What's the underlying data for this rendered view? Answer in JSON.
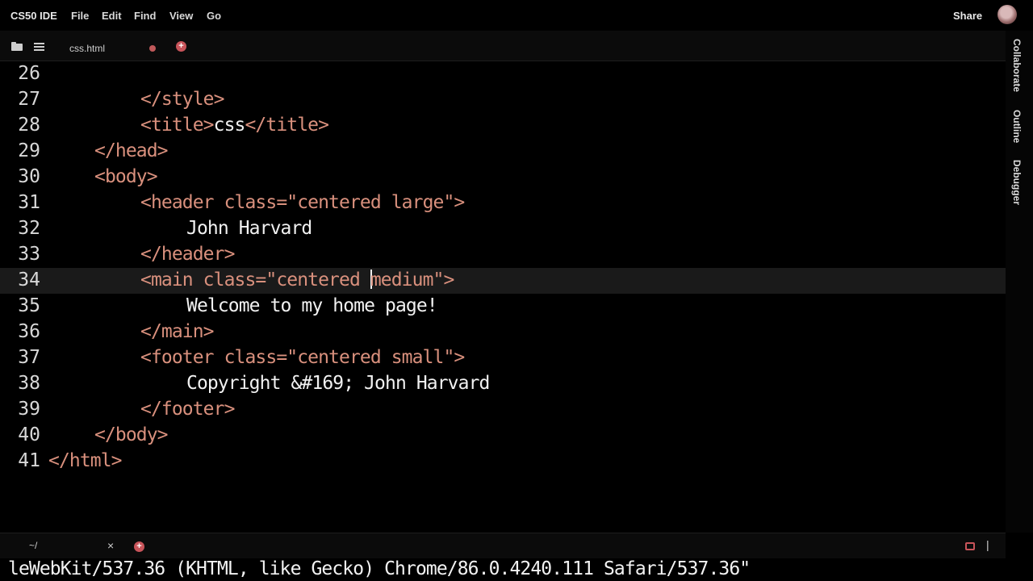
{
  "app": {
    "brand": "CS50 IDE",
    "menu": [
      "File",
      "Edit",
      "Find",
      "View",
      "Go"
    ],
    "share_label": "Share"
  },
  "tabs": {
    "active_file": "css.html",
    "icons": [
      "folder-icon",
      "list-icon",
      "unsaved-dot-icon",
      "plus-icon"
    ]
  },
  "side_panel": [
    "Collaborate",
    "Outline",
    "Debugger"
  ],
  "editor": {
    "active_line": "34",
    "lines": [
      {
        "num": "26",
        "segs": []
      },
      {
        "num": "27",
        "segs": [
          {
            "t": "</style>",
            "c": "tag"
          }
        ]
      },
      {
        "num": "28",
        "segs": [
          {
            "t": "<title>",
            "c": "tag"
          },
          {
            "t": "css",
            "c": "txt"
          },
          {
            "t": "</title>",
            "c": "tag"
          }
        ]
      },
      {
        "num": "29",
        "segs": [
          {
            "t": "</head>",
            "c": "tag"
          }
        ]
      },
      {
        "num": "30",
        "segs": [
          {
            "t": "<body>",
            "c": "tag"
          }
        ]
      },
      {
        "num": "31",
        "segs": [
          {
            "t": "<header class=\"centered large\">",
            "c": "tag"
          }
        ]
      },
      {
        "num": "32",
        "segs": [
          {
            "t": "John Harvard",
            "c": "txt"
          }
        ]
      },
      {
        "num": "33",
        "segs": [
          {
            "t": "</header>",
            "c": "tag"
          }
        ]
      },
      {
        "num": "34",
        "segs": [
          {
            "t": "<main class=\"centered ",
            "c": "tag"
          },
          {
            "t": "",
            "c": "caret"
          },
          {
            "t": "medium\">",
            "c": "tag"
          }
        ]
      },
      {
        "num": "35",
        "segs": [
          {
            "t": "Welcome to my home page!",
            "c": "txt"
          }
        ]
      },
      {
        "num": "36",
        "segs": [
          {
            "t": "</main>",
            "c": "tag"
          }
        ]
      },
      {
        "num": "37",
        "segs": [
          {
            "t": "<footer class=\"centered small\">",
            "c": "tag"
          }
        ]
      },
      {
        "num": "38",
        "segs": [
          {
            "t": "Copyright &#169; John Harvard",
            "c": "txt"
          }
        ]
      },
      {
        "num": "39",
        "segs": [
          {
            "t": "</footer>",
            "c": "tag"
          }
        ]
      },
      {
        "num": "40",
        "segs": [
          {
            "t": "</body>",
            "c": "tag"
          }
        ]
      },
      {
        "num": "41",
        "segs": [
          {
            "t": "</html>",
            "c": "tag"
          }
        ]
      }
    ]
  },
  "terminal": {
    "tab_label": "~/",
    "close_symbol": "×",
    "output": "leWebKit/537.36 (KHTML, like Gecko) Chrome/86.0.4240.111 Safari/537.36\""
  },
  "colors": {
    "tag": "#d9907d",
    "text": "#f1f1f1",
    "accent": "#c8545a",
    "background": "#000000"
  }
}
